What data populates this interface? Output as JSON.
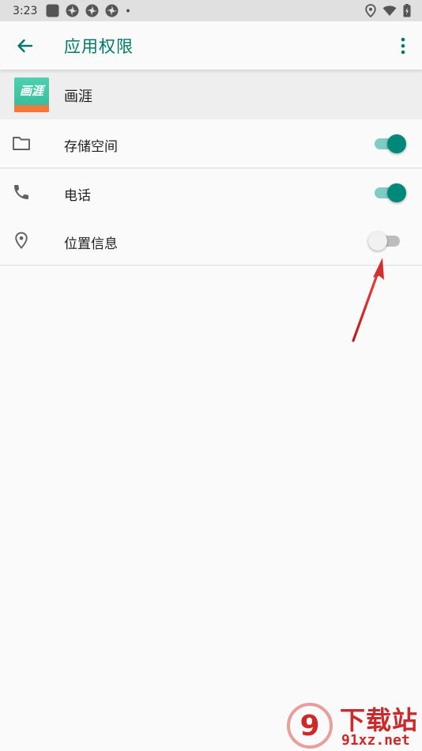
{
  "status_bar": {
    "time": "3:23",
    "notification_icons": [
      "square-app-icon",
      "pinwheel-icon",
      "pinwheel-icon",
      "pinwheel-icon",
      "dot-icon"
    ],
    "system_icons": [
      "location-icon",
      "wifi-icon",
      "battery-charging-icon"
    ]
  },
  "app_bar": {
    "back_icon": "arrow-left-icon",
    "title": "应用权限",
    "more_icon": "more-vert-icon",
    "accent_color": "#00796b"
  },
  "app_info": {
    "icon_text": "画涯",
    "name": "画涯"
  },
  "permissions": [
    {
      "icon": "folder-icon",
      "label": "存储空间",
      "enabled": true
    },
    {
      "icon": "phone-icon",
      "label": "电话",
      "enabled": true
    },
    {
      "icon": "location-pin-icon",
      "label": "位置信息",
      "enabled": false
    }
  ],
  "colors": {
    "toggle_on_thumb": "#00897b",
    "toggle_on_track": "#80cbc4",
    "toggle_off_thumb": "#f1f1f1",
    "toggle_off_track": "#bdbdbd",
    "annotation_arrow": "#d32f2f"
  },
  "watermark": {
    "logo_text": "9",
    "text": "下载站",
    "url": "91xz.net"
  }
}
